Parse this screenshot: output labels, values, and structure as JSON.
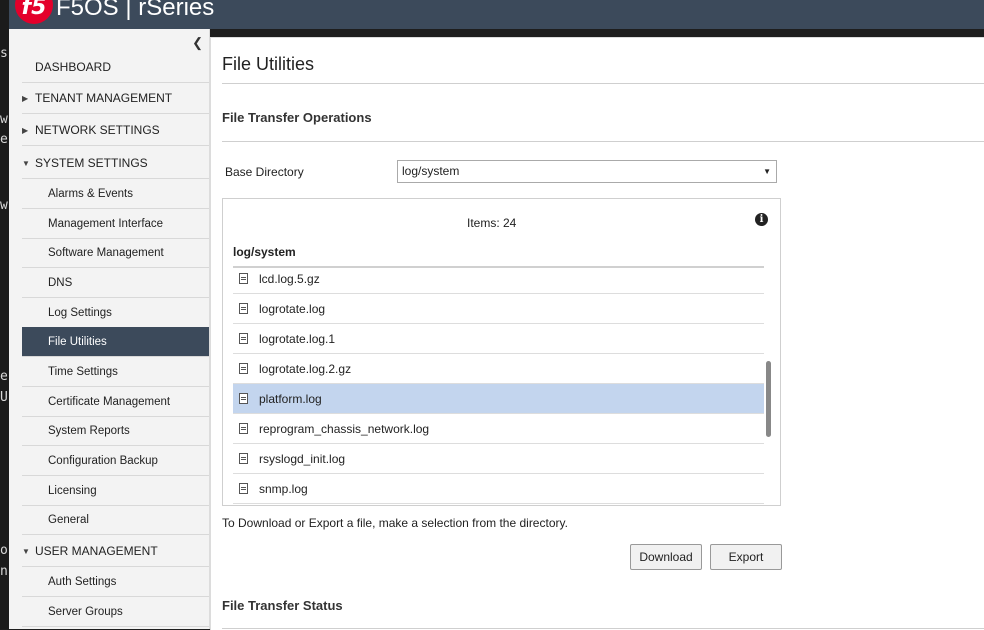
{
  "header": {
    "logo": "f5",
    "product": "F5OS | rSeries"
  },
  "terminal": {
    "fragments": [
      "s.",
      "w",
      "e",
      "w",
      "e",
      "U",
      "o",
      "n"
    ]
  },
  "sidebar": {
    "collapse_icon": "chevron-left-icon",
    "items": [
      {
        "label": "DASHBOARD",
        "level": "top",
        "expander": "none"
      },
      {
        "label": "TENANT MANAGEMENT",
        "level": "top",
        "expander": "collapsed"
      },
      {
        "label": "NETWORK SETTINGS",
        "level": "top",
        "expander": "collapsed"
      },
      {
        "label": "SYSTEM SETTINGS",
        "level": "top",
        "expander": "expanded"
      },
      {
        "label": "Alarms & Events",
        "level": "sub"
      },
      {
        "label": "Management Interface",
        "level": "sub"
      },
      {
        "label": "Software Management",
        "level": "sub"
      },
      {
        "label": "DNS",
        "level": "sub"
      },
      {
        "label": "Log Settings",
        "level": "sub"
      },
      {
        "label": "File Utilities",
        "level": "sub",
        "active": true
      },
      {
        "label": "Time Settings",
        "level": "sub"
      },
      {
        "label": "Certificate Management",
        "level": "sub"
      },
      {
        "label": "System Reports",
        "level": "sub"
      },
      {
        "label": "Configuration Backup",
        "level": "sub"
      },
      {
        "label": "Licensing",
        "level": "sub"
      },
      {
        "label": "General",
        "level": "sub"
      },
      {
        "label": "USER MANAGEMENT",
        "level": "top",
        "expander": "expanded"
      },
      {
        "label": "Auth Settings",
        "level": "sub"
      },
      {
        "label": "Server Groups",
        "level": "sub"
      }
    ]
  },
  "main": {
    "title": "File Utilities",
    "section1": "File Transfer Operations",
    "base_dir_label": "Base Directory",
    "base_dir_value": "log/system",
    "items_count": "Items: 24",
    "dir_label": "log/system",
    "files": [
      {
        "name": "lcd.log.5.gz"
      },
      {
        "name": "logrotate.log"
      },
      {
        "name": "logrotate.log.1"
      },
      {
        "name": "logrotate.log.2.gz"
      },
      {
        "name": "platform.log",
        "selected": true
      },
      {
        "name": "reprogram_chassis_network.log"
      },
      {
        "name": "rsyslogd_init.log"
      },
      {
        "name": "snmp.log"
      }
    ],
    "hint": "To Download or Export a file, make a selection from the directory.",
    "download_label": "Download",
    "export_label": "Export",
    "section2": "File Transfer Status"
  },
  "colors": {
    "header": "#3c4a5b",
    "active_nav": "#3c4a5b",
    "selected_row": "#c3d5ee",
    "logo": "#e4002b"
  }
}
